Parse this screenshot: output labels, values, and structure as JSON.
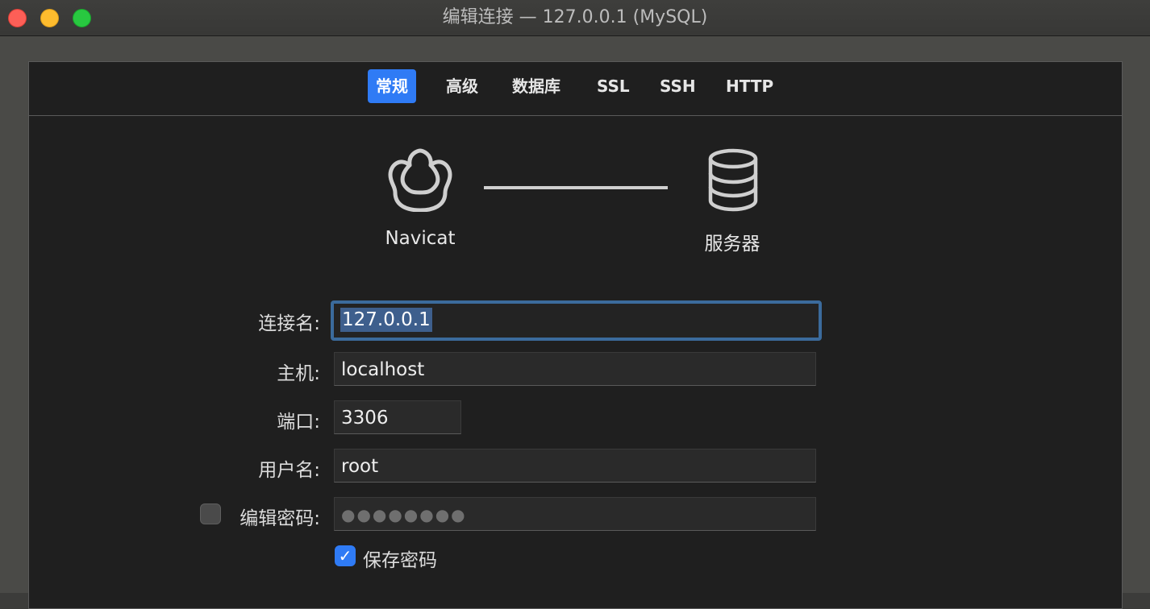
{
  "window": {
    "title": "编辑连接 — 127.0.0.1 (MySQL)"
  },
  "tabs": [
    {
      "label": "常规",
      "active": true
    },
    {
      "label": "高级",
      "active": false
    },
    {
      "label": "数据库",
      "active": false
    },
    {
      "label": "SSL",
      "active": false
    },
    {
      "label": "SSH",
      "active": false
    },
    {
      "label": "HTTP",
      "active": false
    }
  ],
  "diagram": {
    "client_label": "Navicat",
    "server_label": "服务器",
    "client_icon": "navicat-logo-icon",
    "server_icon": "database-icon"
  },
  "form": {
    "connection_name": {
      "label": "连接名:",
      "value": "127.0.0.1"
    },
    "host": {
      "label": "主机:",
      "value": "localhost"
    },
    "port": {
      "label": "端口:",
      "value": "3306"
    },
    "username": {
      "label": "用户名:",
      "value": "root"
    },
    "password": {
      "label": "编辑密码:",
      "value": "●●●●●●●●",
      "edit_checked": false
    },
    "save_password": {
      "label": "保存密码",
      "checked": true,
      "check_glyph": "✓"
    }
  },
  "colors": {
    "accent": "#2f7bf5",
    "panel_background": "#1f1f1f",
    "focus_ring": "#3b6b9c"
  }
}
